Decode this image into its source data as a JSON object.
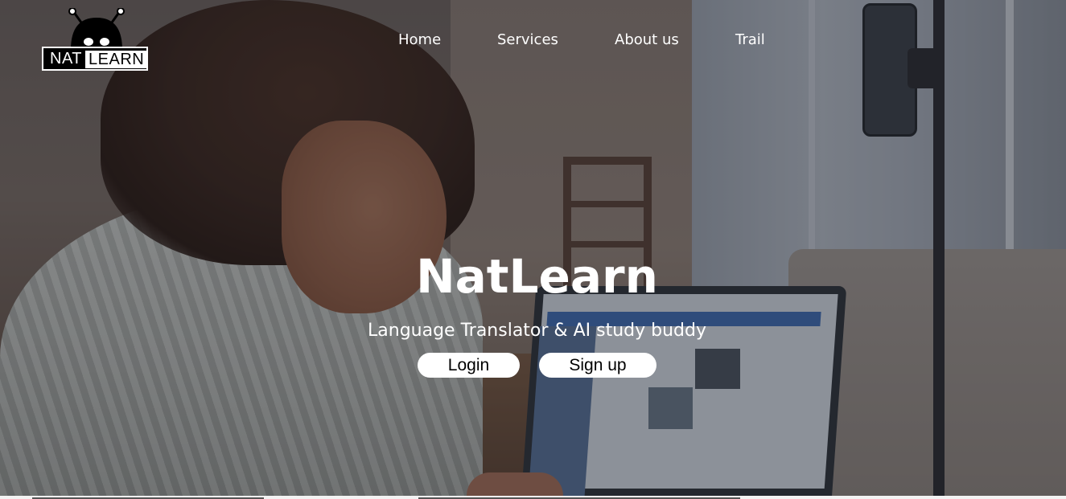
{
  "brand": {
    "logo_left": "NAT",
    "logo_right": "LEARN"
  },
  "nav": {
    "items": [
      {
        "label": "Home"
      },
      {
        "label": "Services"
      },
      {
        "label": "About us"
      },
      {
        "label": "Trail"
      }
    ]
  },
  "hero": {
    "title": "NatLearn",
    "subtitle": "Language Translator & AI study buddy",
    "login_label": "Login",
    "signup_label": "Sign up",
    "background_image": "woman-studying-on-laptop-photo"
  },
  "colors": {
    "text": "#ffffff",
    "button_bg": "#ffffff",
    "button_text": "#000000",
    "logo_bg": "#000000"
  }
}
